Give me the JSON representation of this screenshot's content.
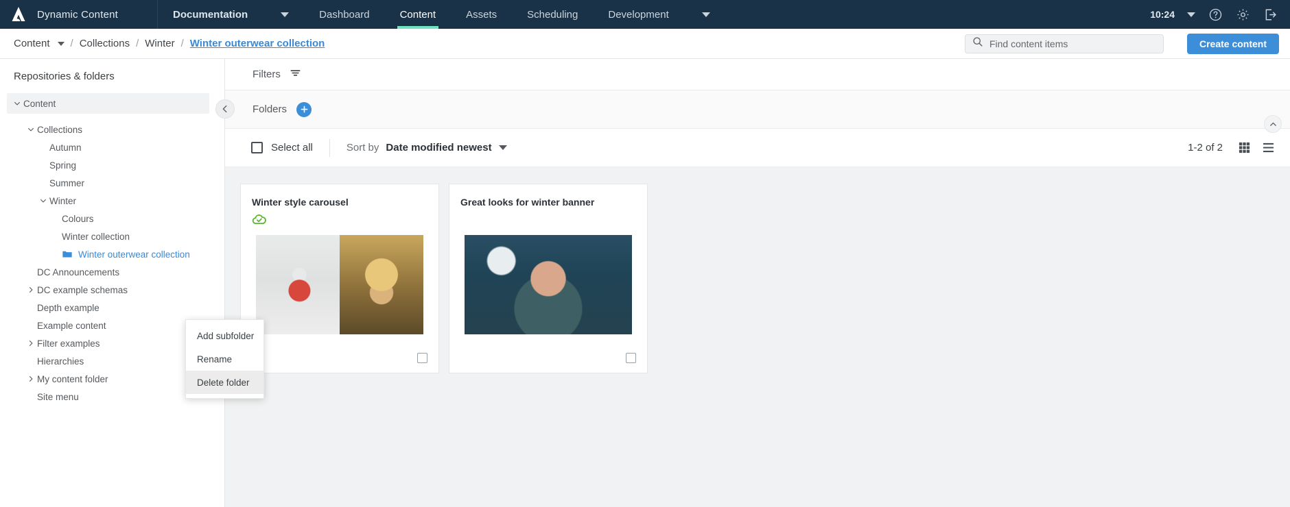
{
  "topnav": {
    "brand": "Dynamic Content",
    "logo_icon": "amplience-logo-icon",
    "items": [
      {
        "label": "Documentation",
        "has_caret": true,
        "bold": true,
        "active": false
      },
      {
        "label": "Dashboard",
        "has_caret": false,
        "bold": false,
        "active": false
      },
      {
        "label": "Content",
        "has_caret": false,
        "bold": false,
        "active": true
      },
      {
        "label": "Assets",
        "has_caret": false,
        "bold": false,
        "active": false
      },
      {
        "label": "Scheduling",
        "has_caret": false,
        "bold": false,
        "active": false
      },
      {
        "label": "Development",
        "has_caret": true,
        "bold": false,
        "active": false
      }
    ],
    "time": "10:24",
    "time_caret_icon": "chevron-down-icon",
    "help_icon": "help-circle-icon",
    "settings_icon": "gear-icon",
    "logout_icon": "logout-icon",
    "background": "#1a3247",
    "active_underline": "#6fe3c0"
  },
  "breadcrumb": {
    "items": [
      {
        "label": "Content",
        "has_caret": true,
        "current": false
      },
      {
        "label": "Collections",
        "has_caret": false,
        "current": false
      },
      {
        "label": "Winter",
        "has_caret": false,
        "current": false
      },
      {
        "label": "Winter outerwear collection",
        "has_caret": false,
        "current": true
      }
    ],
    "separator": "/",
    "current_color": "#3a89d6"
  },
  "search": {
    "placeholder": "Find content items",
    "value": "",
    "icon": "search-icon"
  },
  "create_button": {
    "label": "Create content",
    "color": "#3d8ed9"
  },
  "sidebar": {
    "title": "Repositories & folders",
    "collapse_icon": "chevron-left-icon",
    "tree": [
      {
        "label": "Content",
        "indent": 0,
        "twisty": "down",
        "root": true,
        "selected": false,
        "folder_icon": false
      },
      {
        "label": "Collections",
        "indent": 1,
        "twisty": "down",
        "root": false,
        "selected": false,
        "folder_icon": false
      },
      {
        "label": "Autumn",
        "indent": 2,
        "twisty": "none",
        "root": false,
        "selected": false,
        "folder_icon": false
      },
      {
        "label": "Spring",
        "indent": 2,
        "twisty": "none",
        "root": false,
        "selected": false,
        "folder_icon": false
      },
      {
        "label": "Summer",
        "indent": 2,
        "twisty": "none",
        "root": false,
        "selected": false,
        "folder_icon": false
      },
      {
        "label": "Winter",
        "indent": 2,
        "twisty": "down",
        "root": false,
        "selected": false,
        "folder_icon": false
      },
      {
        "label": "Colours",
        "indent": 3,
        "twisty": "none",
        "root": false,
        "selected": false,
        "folder_icon": false
      },
      {
        "label": "Winter collection",
        "indent": 3,
        "twisty": "none",
        "root": false,
        "selected": false,
        "folder_icon": false
      },
      {
        "label": "Winter outerwear collection",
        "indent": 3,
        "twisty": "none",
        "root": false,
        "selected": true,
        "folder_icon": true
      },
      {
        "label": "DC Announcements",
        "indent": 1,
        "twisty": "none",
        "root": false,
        "selected": false,
        "folder_icon": false
      },
      {
        "label": "DC example schemas",
        "indent": 1,
        "twisty": "right",
        "root": false,
        "selected": false,
        "folder_icon": false
      },
      {
        "label": "Depth example",
        "indent": 1,
        "twisty": "none",
        "root": false,
        "selected": false,
        "folder_icon": false
      },
      {
        "label": "Example content",
        "indent": 1,
        "twisty": "none",
        "root": false,
        "selected": false,
        "folder_icon": false
      },
      {
        "label": "Filter examples",
        "indent": 1,
        "twisty": "right",
        "root": false,
        "selected": false,
        "folder_icon": false
      },
      {
        "label": "Hierarchies",
        "indent": 1,
        "twisty": "none",
        "root": false,
        "selected": false,
        "folder_icon": false
      },
      {
        "label": "My content folder",
        "indent": 1,
        "twisty": "right",
        "root": false,
        "selected": false,
        "folder_icon": false
      },
      {
        "label": "Site menu",
        "indent": 1,
        "twisty": "none",
        "root": false,
        "selected": false,
        "folder_icon": false
      }
    ],
    "selected_color": "#3a89d6"
  },
  "context_menu": {
    "items": [
      {
        "label": "Add subfolder",
        "hovered": false
      },
      {
        "label": "Rename",
        "hovered": false
      },
      {
        "label": "Delete folder",
        "hovered": true
      }
    ]
  },
  "filters": {
    "label": "Filters",
    "icon": "filter-icon"
  },
  "folders_bar": {
    "label": "Folders",
    "add_icon": "plus-icon",
    "collapse_icon": "chevron-up-icon"
  },
  "list_toolbar": {
    "select_all_label": "Select all",
    "select_all_checked": false,
    "sort_label": "Sort by",
    "sort_value": "Date modified newest",
    "sort_caret_icon": "chevron-down-icon",
    "pager": "1-2 of 2",
    "grid_view_icon": "grid-view-icon",
    "list_view_icon": "list-view-icon",
    "active_view": "grid"
  },
  "cards": [
    {
      "title": "Winter style carousel",
      "status_icon": "cloud-published-icon",
      "status_color": "#5cb533",
      "has_status": true,
      "thumb_style": "split",
      "checked": false
    },
    {
      "title": "Great looks for winter banner",
      "status_icon": "",
      "status_color": "",
      "has_status": false,
      "thumb_style": "single",
      "checked": false
    }
  ]
}
